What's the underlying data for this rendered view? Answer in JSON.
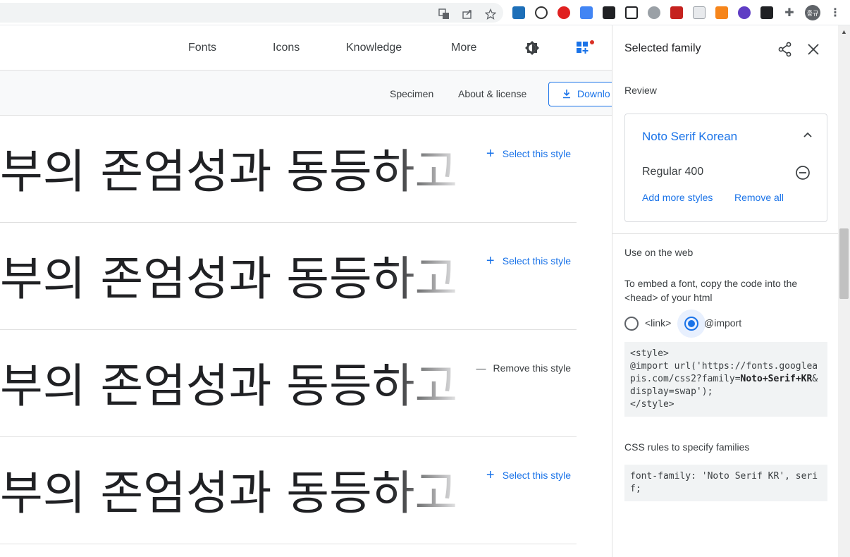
{
  "browser": {
    "extensions": [
      "translate-icon",
      "share-icon",
      "bookmark-star-icon"
    ],
    "avatar_text": "종규"
  },
  "topnav": {
    "items": [
      "Fonts",
      "Icons",
      "Knowledge",
      "More"
    ]
  },
  "subnav": {
    "specimen": "Specimen",
    "about": "About & license",
    "download": "Downlo"
  },
  "styles": {
    "sample_text": "부의 존엄성과 동등하고",
    "rows": [
      {
        "action": "Select this style",
        "symbol": "+"
      },
      {
        "action": "Select this style",
        "symbol": "+"
      },
      {
        "action": "Remove this style",
        "symbol": "—"
      },
      {
        "action": "Select this style",
        "symbol": "+"
      }
    ]
  },
  "panel": {
    "title": "Selected family",
    "review_label": "Review",
    "family_name": "Noto Serif Korean",
    "variant": "Regular 400",
    "add_more": "Add more styles",
    "remove_all": "Remove all",
    "web_title": "Use on the web",
    "embed_help": "To embed a font, copy the code into the <head> of your html",
    "radio_link": "<link>",
    "radio_import": "@import",
    "selected_option": "@import",
    "code_import_pre": "<style>\n@import url('https://fonts.googleapis.com/css2?family=",
    "code_import_bold": "Noto+Serif+KR",
    "code_import_post": "&display=swap');\n</style>",
    "css_rules_title": "CSS rules to specify families",
    "css_rule": "font-family: 'Noto Serif KR', serif;"
  },
  "colors": {
    "accent": "#1a73e8",
    "text": "#3c4043",
    "divider": "#e0e0e0"
  }
}
